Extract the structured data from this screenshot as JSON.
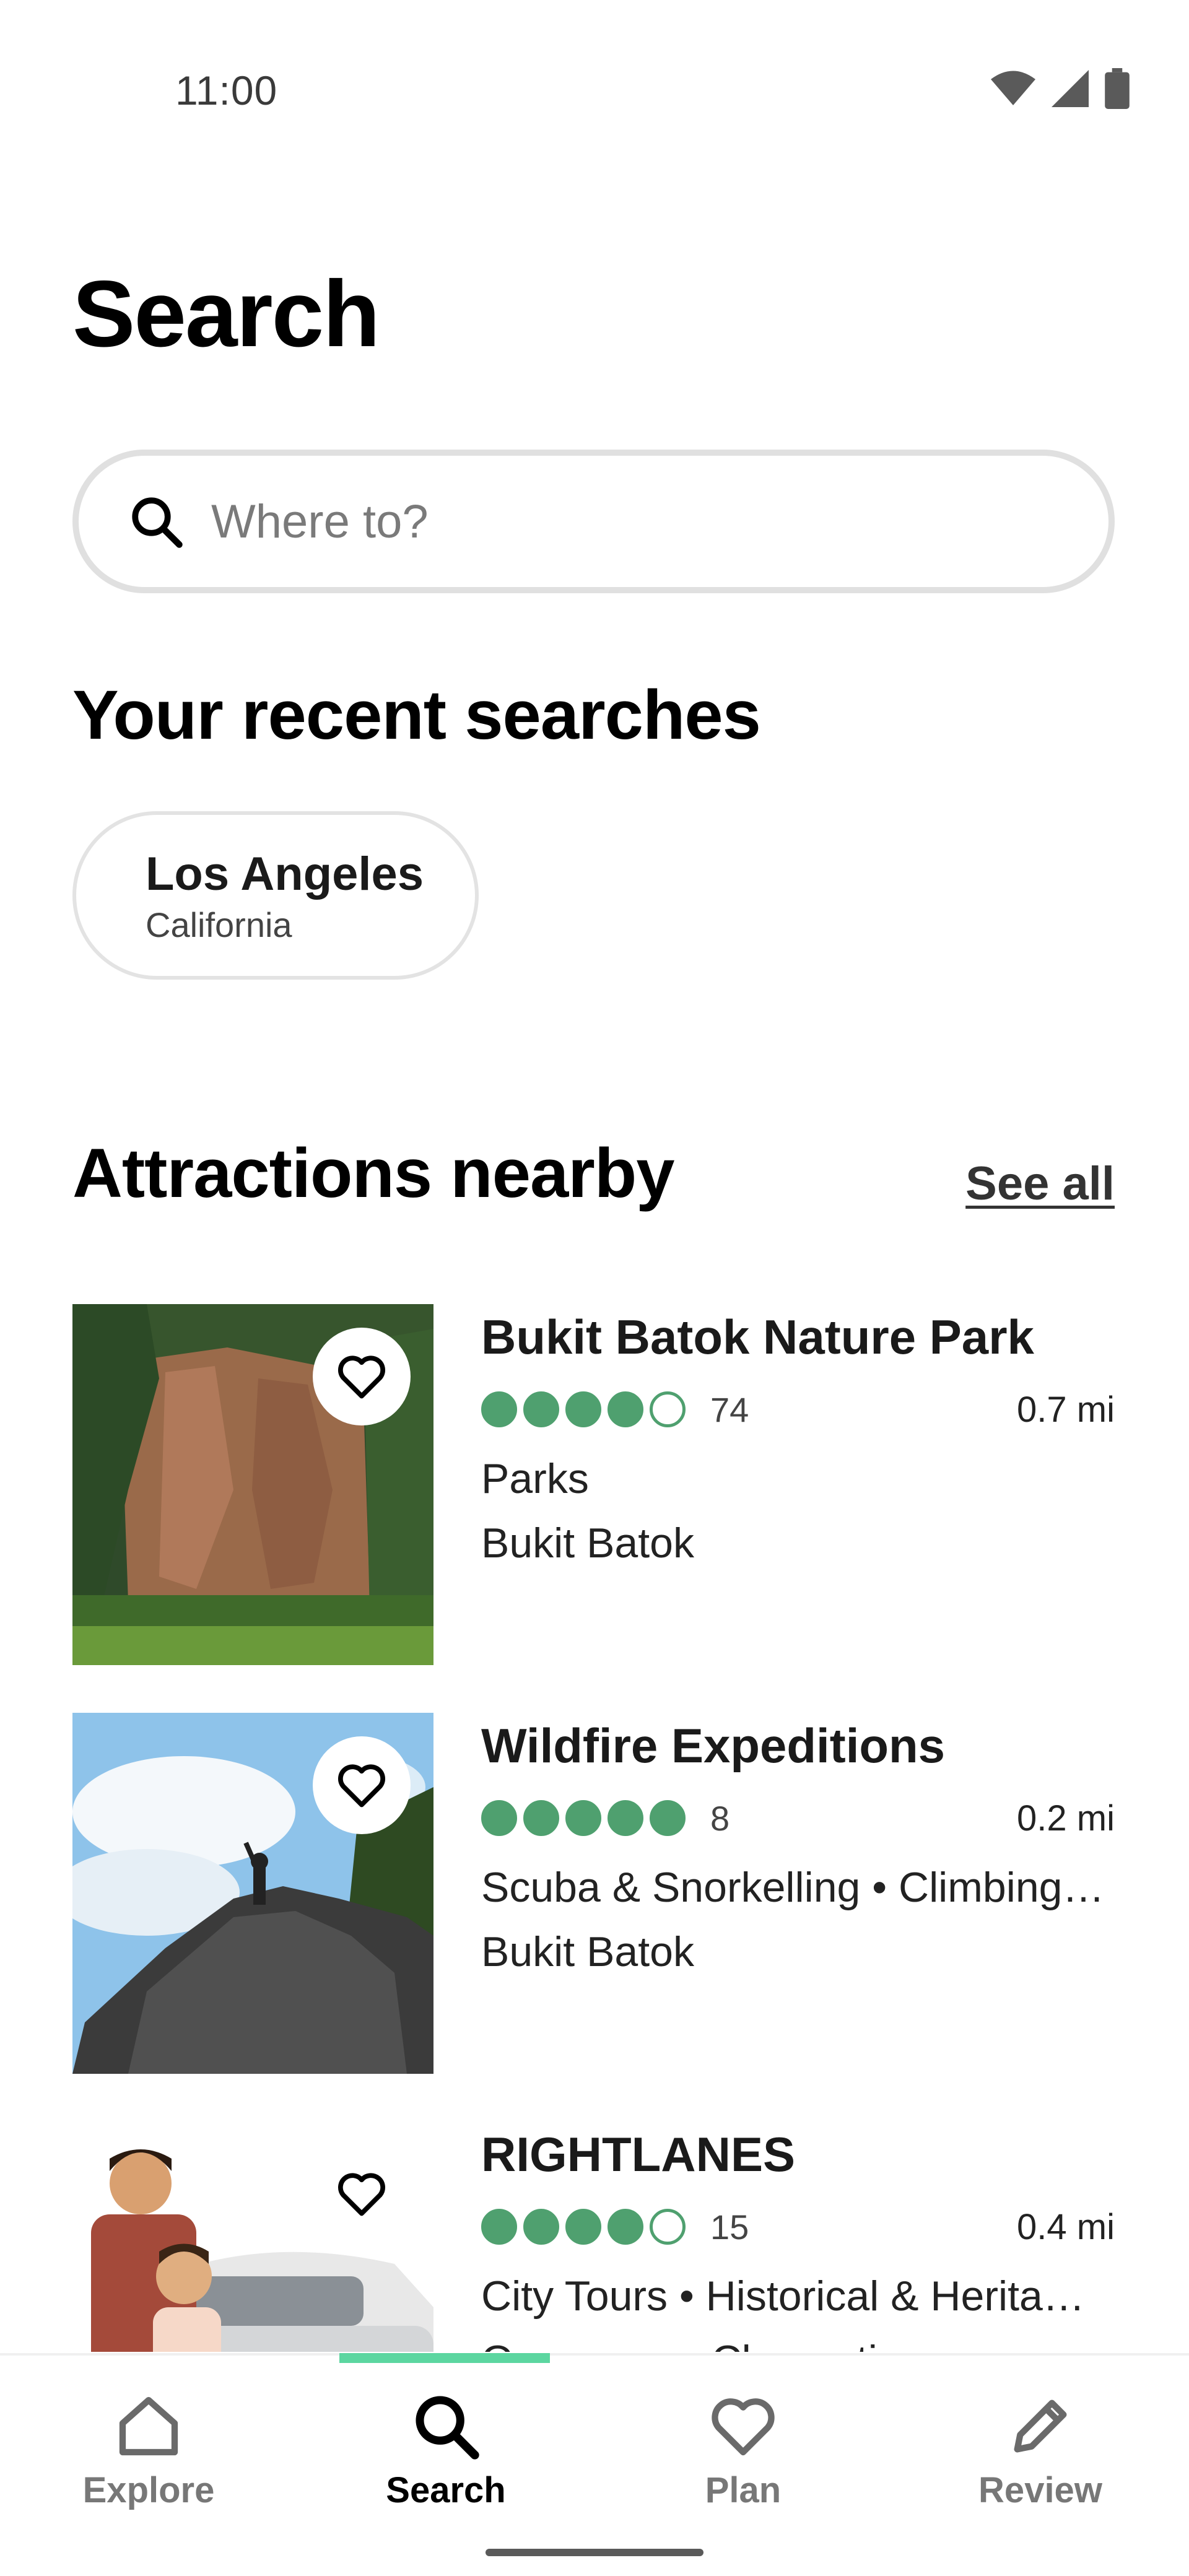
{
  "status_bar": {
    "time": "11:00",
    "icons": [
      "wifi-icon",
      "signal-icon",
      "battery-icon"
    ]
  },
  "page_title": "Search",
  "search": {
    "placeholder": "Where to?",
    "value": ""
  },
  "recent": {
    "title": "Your recent searches",
    "items": [
      {
        "title": "Los Angeles",
        "subtitle": "California"
      }
    ]
  },
  "attractions": {
    "title": "Attractions nearby",
    "see_all": "See all",
    "items": [
      {
        "name": "Bukit Batok Nature Park",
        "rating": 4,
        "reviews": "74",
        "distance": "0.7 mi",
        "category": "Parks",
        "location": "Bukit Batok"
      },
      {
        "name": "Wildfire Expeditions",
        "rating": 5,
        "reviews": "8",
        "distance": "0.2 mi",
        "category": "Scuba & Snorkelling • Climbing…",
        "location": "Bukit Batok"
      },
      {
        "name": "RIGHTLANES",
        "rating": 4,
        "reviews": "15",
        "distance": "0.4 mi",
        "category": "City Tours • Historical & Herita…",
        "location": "Open now • Clementi"
      }
    ]
  },
  "nav": {
    "active": "Search",
    "items": [
      {
        "label": "Explore",
        "icon": "home-icon"
      },
      {
        "label": "Search",
        "icon": "search-icon"
      },
      {
        "label": "Plan",
        "icon": "heart-icon"
      },
      {
        "label": "Review",
        "icon": "pencil-icon"
      }
    ]
  },
  "colors": {
    "accent_green": "#4fa06f",
    "nav_indicator": "#5cd6a0",
    "border": "#e0e0e0"
  }
}
